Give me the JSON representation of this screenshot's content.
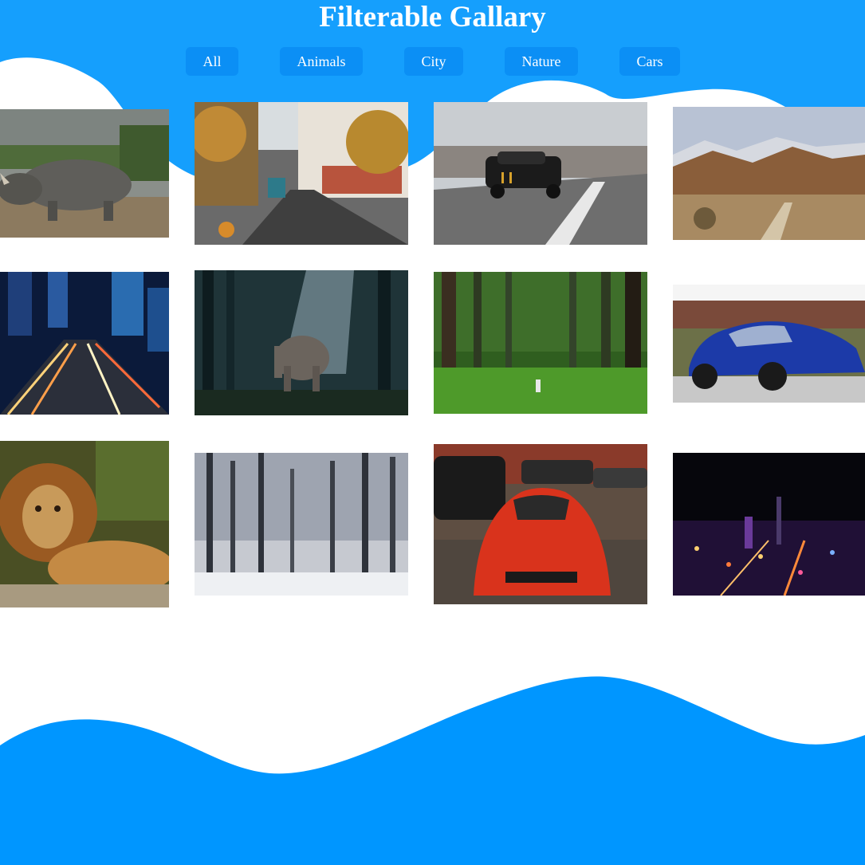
{
  "header": {
    "title": "Filterable Gallary"
  },
  "filters": [
    {
      "label": "All"
    },
    {
      "label": "Animals"
    },
    {
      "label": "City"
    },
    {
      "label": "Nature"
    },
    {
      "label": "Cars"
    }
  ],
  "gallery": {
    "photos": [
      {
        "subject": "rhinoceros",
        "category": "Animals"
      },
      {
        "subject": "autumn city street with tram",
        "category": "City"
      },
      {
        "subject": "black muscle car on highway",
        "category": "Cars"
      },
      {
        "subject": "desert mountain landscape",
        "category": "Nature"
      },
      {
        "subject": "city highway light trails at night",
        "category": "City"
      },
      {
        "subject": "elephant in misty forest",
        "category": "Animals"
      },
      {
        "subject": "green pine forest",
        "category": "Nature"
      },
      {
        "subject": "blue sedan",
        "category": "Cars"
      },
      {
        "subject": "lion resting",
        "category": "Animals"
      },
      {
        "subject": "snowy winter forest",
        "category": "Nature"
      },
      {
        "subject": "red sports car",
        "category": "Cars"
      },
      {
        "subject": "city skyline at night",
        "category": "City"
      }
    ]
  },
  "colors": {
    "brand_blue": "#0096ff",
    "button_blue": "#0b8ff5",
    "text_white": "#ffffff"
  }
}
